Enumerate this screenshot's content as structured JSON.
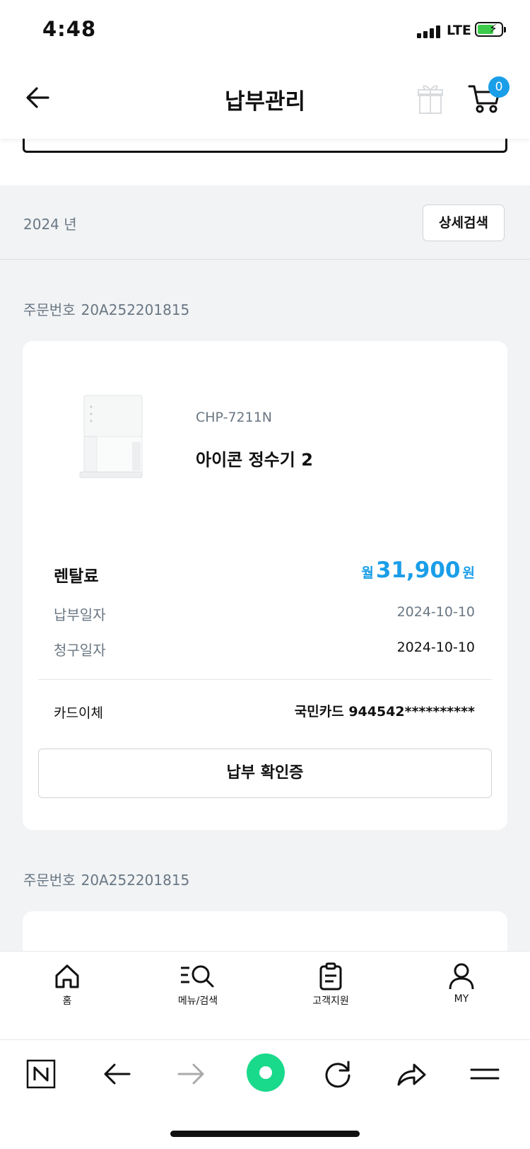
{
  "status_bar": {
    "time": "4:48",
    "network": "LTE"
  },
  "header": {
    "title": "납부관리",
    "cart_count": "0"
  },
  "filter": {
    "year": "2024 년",
    "detail_search": "상세검색"
  },
  "orders": [
    {
      "order_label": "주문번호",
      "order_number": "20A252201815",
      "model": "CHP-7211N",
      "product_name": "아이콘 정수기 2",
      "fee_label": "렌탈료",
      "fee_prefix": "월",
      "fee_amount": "31,900",
      "fee_suffix": "원",
      "paid_date_label": "납부일자",
      "paid_date": "2024-10-10",
      "bill_date_label": "청구일자",
      "bill_date": "2024-10-10",
      "pay_method_label": "카드이체",
      "pay_method_value": "국민카드 944542**********",
      "receipt_button": "납부 확인증"
    },
    {
      "order_label": "주문번호",
      "order_number": "20A252201815"
    }
  ],
  "bottom_nav": [
    {
      "label": "홈",
      "icon": "home-icon"
    },
    {
      "label": "메뉴/검색",
      "icon": "menu-search-icon"
    },
    {
      "label": "고객지원",
      "icon": "clipboard-icon"
    },
    {
      "label": "MY",
      "icon": "user-icon"
    }
  ],
  "browser_toolbar": [
    "naver-icon",
    "back-arrow-icon",
    "forward-arrow-icon",
    "green-dot-icon",
    "refresh-icon",
    "share-icon",
    "menu-icon"
  ],
  "colors": {
    "accent": "#1a9ee8",
    "browser_green": "#19d98b",
    "battery": "#3ccb4a"
  }
}
